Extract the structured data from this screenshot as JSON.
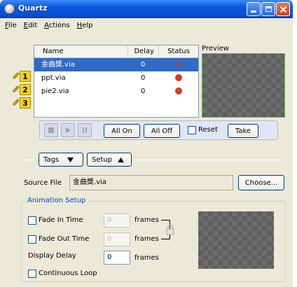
{
  "window": {
    "title": "Quartz"
  },
  "menu": [
    {
      "key": "F",
      "rest": "ile"
    },
    {
      "key": "E",
      "rest": "dit"
    },
    {
      "key": "A",
      "rest": "ctions"
    },
    {
      "key": "H",
      "rest": "elp"
    }
  ],
  "list": {
    "columns": [
      "Name",
      "Delay",
      "Status"
    ],
    "rows": [
      {
        "num": "1",
        "name": "金曲獎.via",
        "delay": "0",
        "status_color": "#6a5a8a",
        "selected": true
      },
      {
        "num": "2",
        "name": "ppt.via",
        "delay": "0",
        "status_color": "#d63a1a",
        "selected": false
      },
      {
        "num": "3",
        "name": "pie2.via",
        "delay": "0",
        "status_color": "#d63a1a",
        "selected": false
      }
    ]
  },
  "preview": {
    "label": "Preview"
  },
  "controls": {
    "all_on": "All On",
    "all_off": "All Off",
    "reset": "Reset",
    "take": "Take"
  },
  "tabs": {
    "tags": "Tags",
    "setup": "Setup"
  },
  "source": {
    "label": "Source File",
    "value": "金曲獎.via",
    "choose": "Choose..."
  },
  "animation": {
    "legend": "Animation Setup",
    "fade_in_label": "Fade In Time",
    "fade_in_value": "0",
    "fade_out_label": "Fade Out Time",
    "fade_out_value": "0",
    "display_delay_label": "Display Delay",
    "display_delay_value": "0",
    "frames": "frames",
    "continuous_loop": "Continuous Loop"
  },
  "colors": {
    "accent": "#0a55e0",
    "selection": "#316ac5",
    "preview_border": "#55bb55"
  }
}
